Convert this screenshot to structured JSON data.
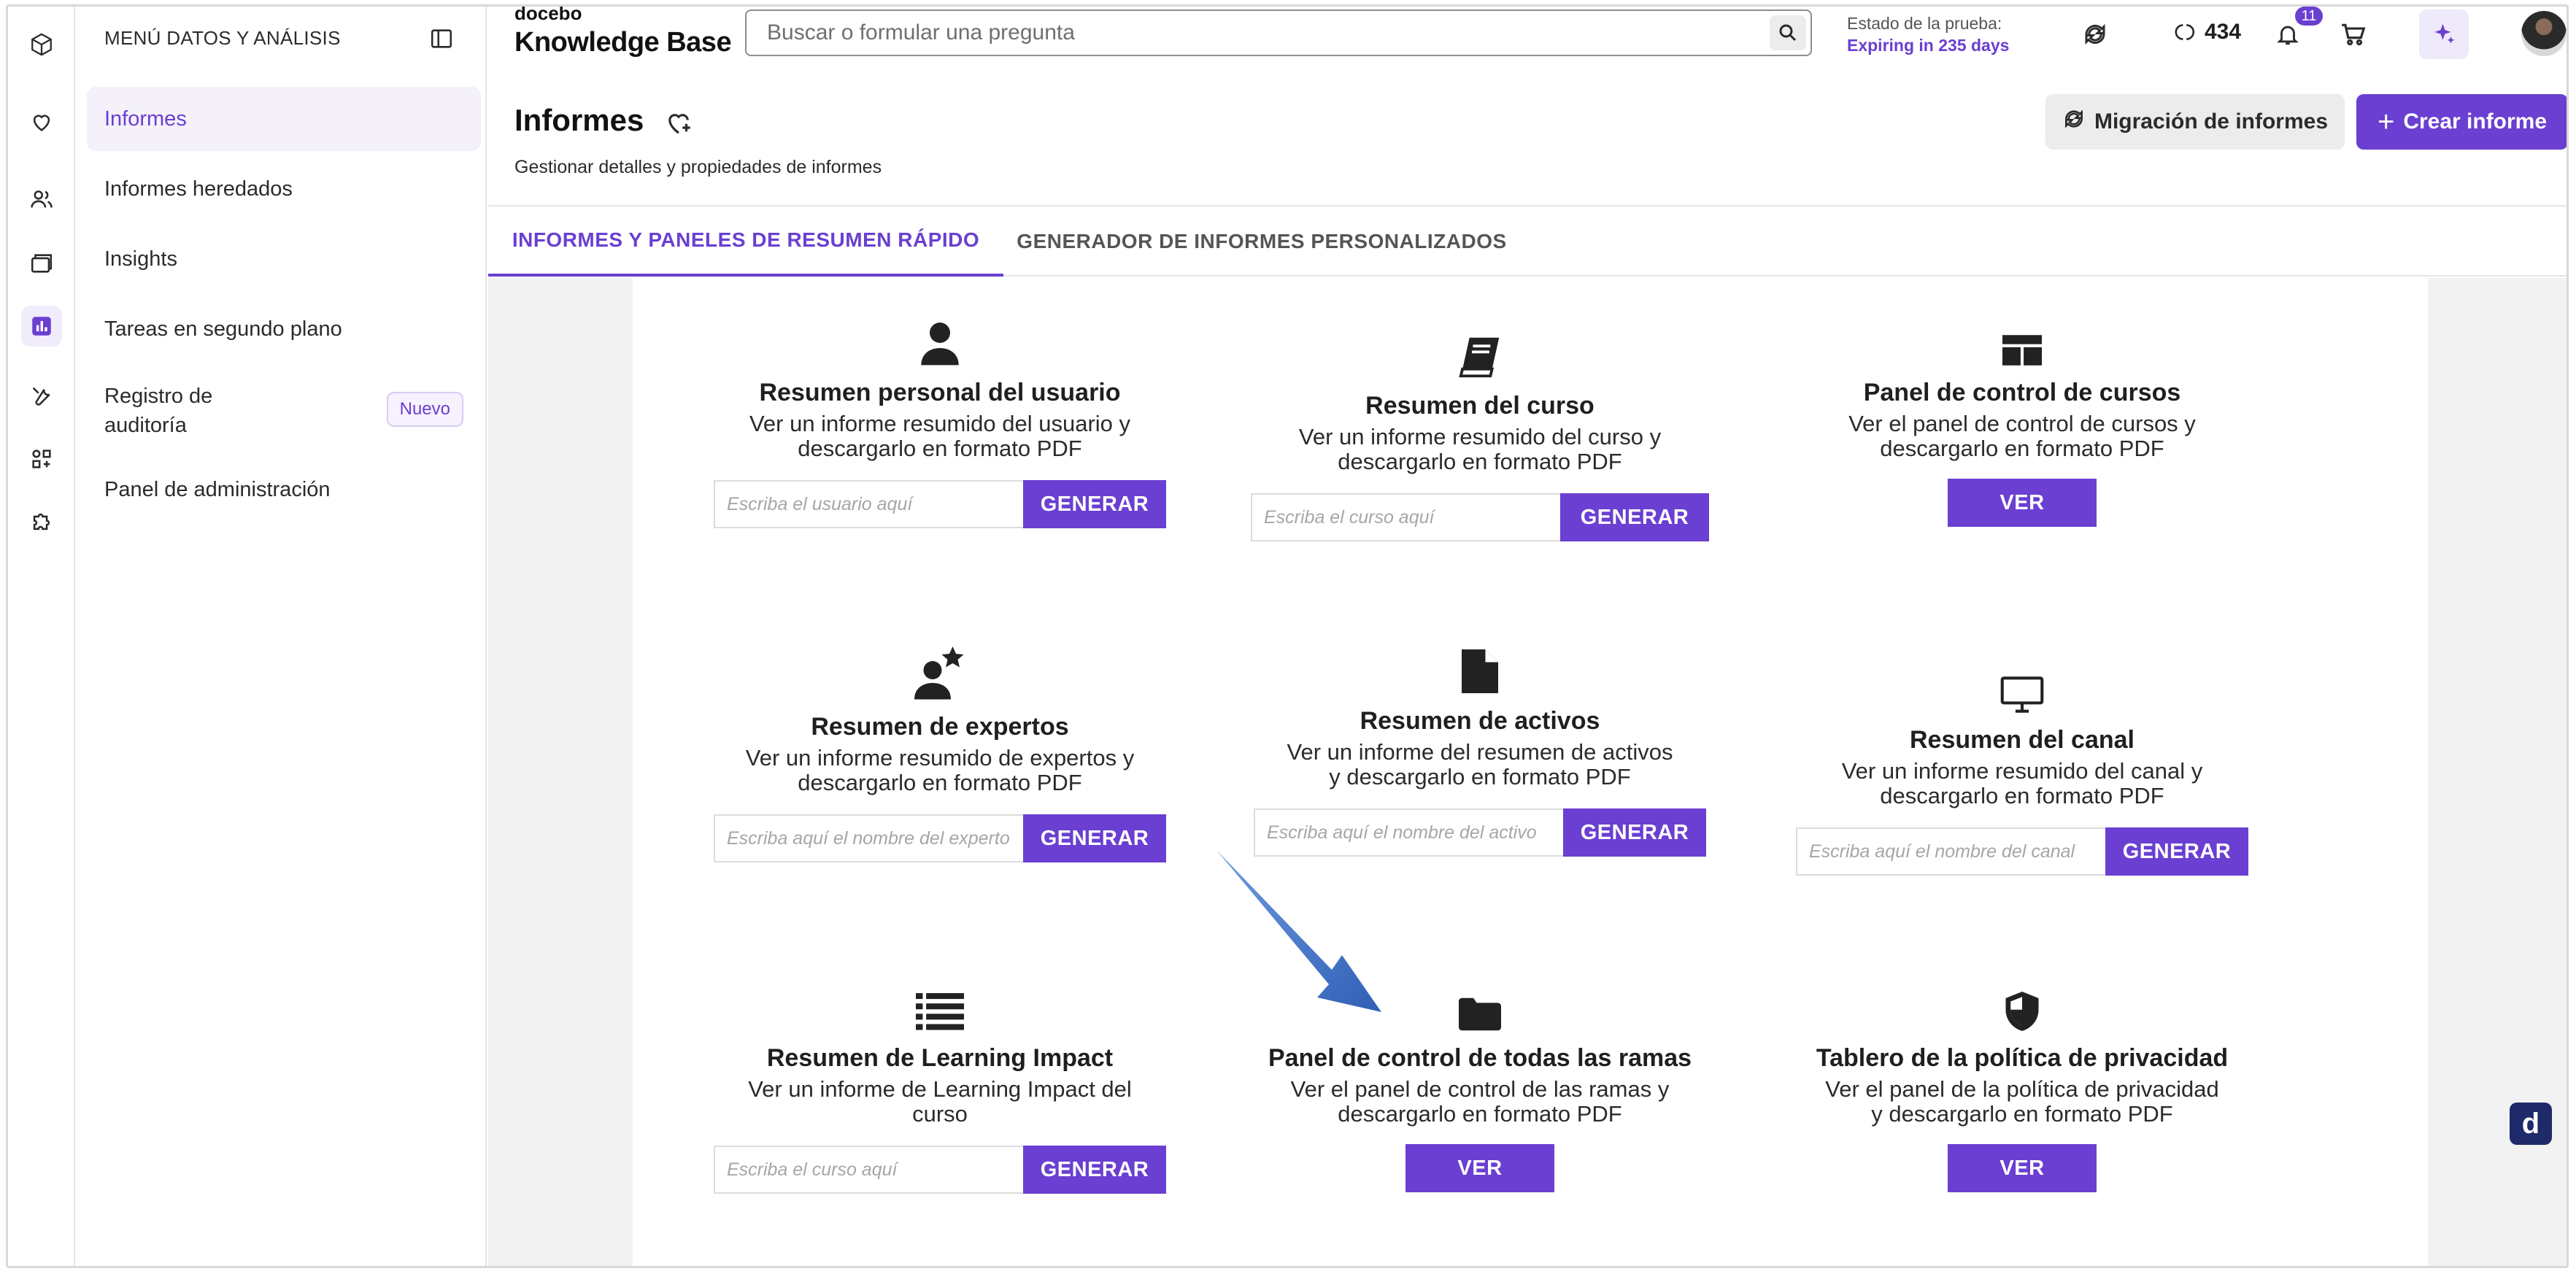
{
  "sidebar": {
    "header": "MENÚ DATOS Y ANÁLISIS",
    "items": [
      {
        "label": "Informes",
        "active": true
      },
      {
        "label": "Informes heredados"
      },
      {
        "label": "Insights"
      },
      {
        "label": "Tareas en segundo plano"
      },
      {
        "label": "Registro de",
        "label2": "auditoría",
        "badge": "Nuevo"
      },
      {
        "label": "Panel de administración"
      }
    ]
  },
  "rail_icons": [
    "cube-icon",
    "heart-icon",
    "users-icon",
    "folders-icon",
    "analytics-icon",
    "tools-icon",
    "apps-icon",
    "puzzle-icon"
  ],
  "topbar": {
    "brand_small": "docebo",
    "brand": "Knowledge Base",
    "search_placeholder": "Buscar o formular una pregunta",
    "trial_label": "Estado de la prueba:",
    "trial_value": "Expiring in 235 days",
    "credits": "434",
    "notifications": "11"
  },
  "page": {
    "title": "Informes",
    "subtitle": "Gestionar detalles y propiedades de informes",
    "migrate_label": "Migración de informes",
    "create_label": "Crear informe"
  },
  "tabs": [
    {
      "label": "INFORMES Y PANELES DE RESUMEN RÁPIDO",
      "active": true
    },
    {
      "label": "GENERADOR DE INFORMES PERSONALIZADOS"
    }
  ],
  "cards": [
    {
      "title": "Resumen personal del usuario",
      "desc": "Ver un informe resumido del usuario y descargarlo en formato PDF",
      "placeholder": "Escriba el usuario aquí",
      "button": "GENERAR",
      "icon": "user-icon"
    },
    {
      "title": "Resumen del curso",
      "desc": "Ver un informe resumido del curso y descargarlo en formato PDF",
      "placeholder": "Escriba el curso aquí",
      "button": "GENERAR",
      "icon": "book-icon"
    },
    {
      "title": "Panel de control de cursos",
      "desc": "Ver el panel de control de cursos y descargarlo en formato PDF",
      "button": "VER",
      "icon": "dashboard-icon"
    },
    {
      "title": "Resumen de expertos",
      "desc": "Ver un informe resumido de expertos y descargarlo en formato PDF",
      "placeholder": "Escriba aquí el nombre del experto",
      "button": "GENERAR",
      "icon": "expert-icon"
    },
    {
      "title": "Resumen de activos",
      "desc": "Ver un informe del resumen de activos y descargarlo en formato PDF",
      "placeholder": "Escriba aquí el nombre del activo",
      "button": "GENERAR",
      "icon": "file-icon"
    },
    {
      "title": "Resumen del canal",
      "desc": "Ver un informe resumido del canal y descargarlo en formato PDF",
      "placeholder": "Escriba aquí el nombre del canal",
      "button": "GENERAR",
      "icon": "monitor-icon"
    },
    {
      "title": "Resumen de Learning Impact",
      "desc": "Ver un informe de Learning Impact del curso",
      "placeholder": "Escriba el curso aquí",
      "button": "GENERAR",
      "icon": "list-icon"
    },
    {
      "title": "Panel de control de todas las ramas",
      "desc": "Ver el panel de control de las ramas y descargarlo en formato PDF",
      "button": "VER",
      "icon": "folder-icon"
    },
    {
      "title": "Tablero de la política de privacidad",
      "desc": "Ver el panel de la política de privacidad y descargarlo en formato PDF",
      "button": "VER",
      "icon": "shield-icon"
    }
  ],
  "widget": {
    "letter": "d"
  },
  "colors": {
    "accent": "#6a3fd1",
    "arrow": "#3b6cc4"
  }
}
